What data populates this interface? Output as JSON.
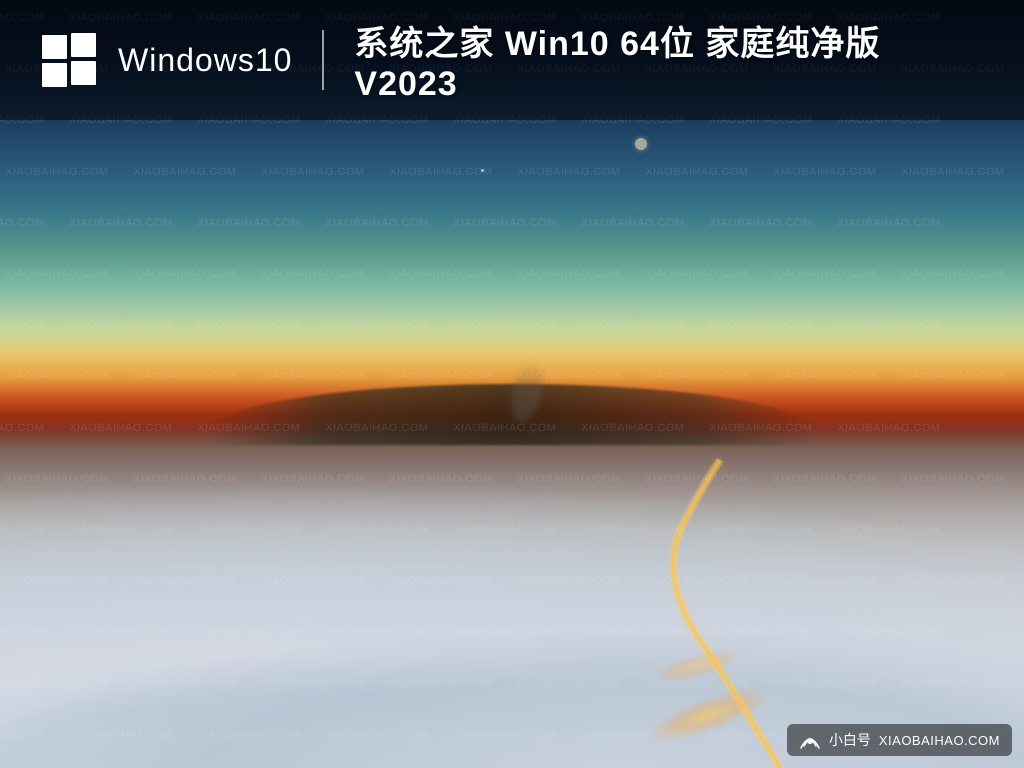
{
  "header": {
    "win_label": "Windows10",
    "subtitle": "系统之家 Win10 64位 家庭纯净版 V2023",
    "divider_visible": true
  },
  "watermark": {
    "text": "XIAOBAIHAO.COM",
    "rows": 20,
    "cols": 8
  },
  "badge": {
    "icon_text": "((●))",
    "cn_text": "小白号",
    "en_text": "XIAOBAIHAO.COM"
  },
  "windows_logo": {
    "color_tl": "#00adef",
    "color_tr": "#00adef",
    "color_bl": "#00adef",
    "color_br": "#00adef"
  }
}
